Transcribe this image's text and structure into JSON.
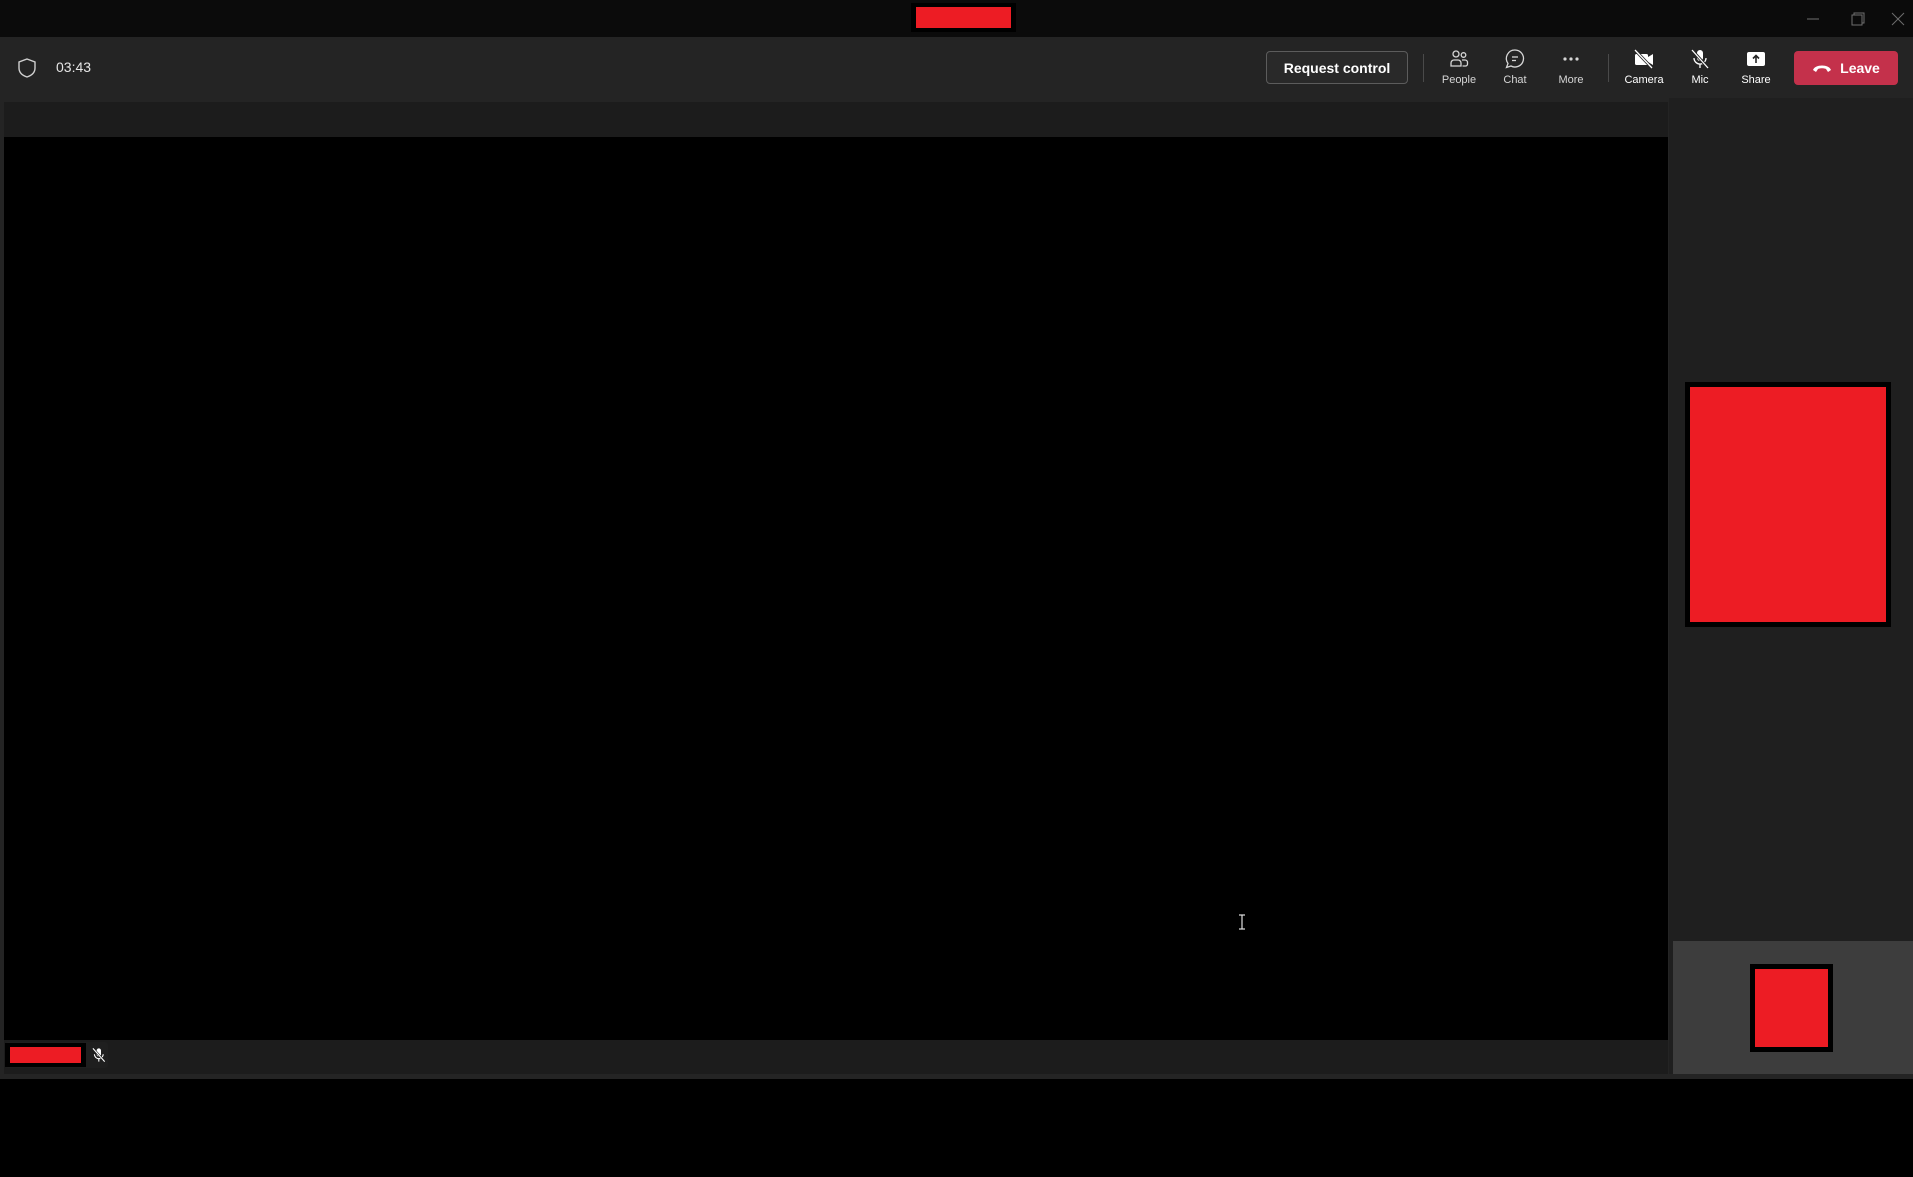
{
  "window": {
    "title_redacted": true,
    "controls": {
      "minimize_icon": "minimize-icon",
      "restore_icon": "restore-icon",
      "close_icon": "close-icon"
    }
  },
  "meeting_bar": {
    "security_icon": "shield-icon",
    "elapsed_time": "03:43",
    "request_control_label": "Request control",
    "tools": [
      {
        "id": "people",
        "label": "People",
        "icon": "people-icon"
      },
      {
        "id": "chat",
        "label": "Chat",
        "icon": "chat-icon"
      },
      {
        "id": "more",
        "label": "More",
        "icon": "more-icon"
      },
      {
        "id": "camera",
        "label": "Camera",
        "icon": "camera-off-icon"
      },
      {
        "id": "mic",
        "label": "Mic",
        "icon": "mic-off-icon"
      },
      {
        "id": "share",
        "label": "Share",
        "icon": "share-icon"
      }
    ],
    "leave_label": "Leave",
    "leave_icon": "hang-up-icon"
  },
  "stage": {
    "presenter_name_redacted": true,
    "presenter_muted": true
  },
  "participants_rail": {
    "tiles": [
      {
        "name_redacted": true
      }
    ],
    "self_view": {
      "redacted": true
    }
  },
  "colors": {
    "leave_button": "#c4314b",
    "redaction": "#ed1c24",
    "toolbar_bg": "#242424",
    "stage_bg": "#000000",
    "self_view_bg": "#3d3d3d"
  }
}
